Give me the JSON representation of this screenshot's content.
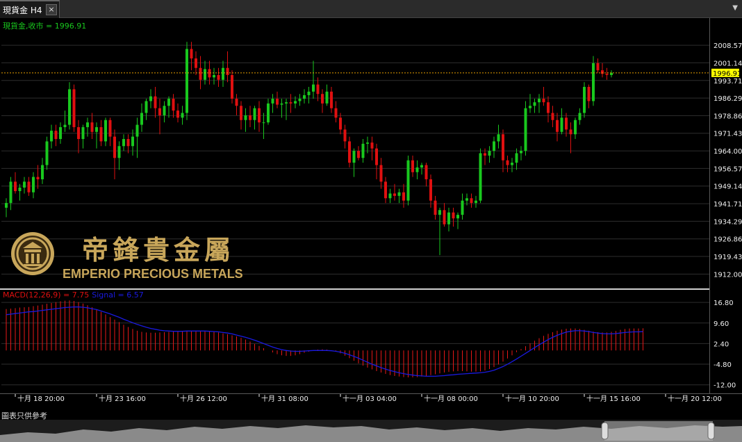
{
  "tab": {
    "title": "現貨金 H4",
    "close_label": "×",
    "menu_glyph": "▼"
  },
  "colors": {
    "up": "#19c81e",
    "down": "#e01010",
    "grid": "#2e2e2e",
    "axis_text": "#f0f0f0",
    "price_line": "#e8a000",
    "signal": "#1a1ae0",
    "macd_hist": "#e81818",
    "price_label_bg": "#ffff00"
  },
  "logo": {
    "chinese": "帝鋒貴金屬",
    "english": "EMPERIO PRECIOUS METALS",
    "icon": "emperio-emblem-icon"
  },
  "footer_note": "圖表只供參考",
  "chart_data": [
    {
      "type": "candlestick",
      "header_label": "現貨金,收市 = 1996.91",
      "last_price": 1996.91,
      "last_price_label": "1996.91",
      "ylim": [
        1908,
        2013
      ],
      "y_ticks": [
        "2008.57",
        "2001.14",
        "1993.71",
        "1986.29",
        "1978.86",
        "1971.43",
        "1964.00",
        "1956.57",
        "1949.14",
        "1941.71",
        "1934.29",
        "1926.86",
        "1919.43",
        "1912.00"
      ],
      "x_ticks": [
        "十月 18 20:00",
        "十月 23 16:00",
        "十月 26 12:00",
        "十月 31 08:00",
        "十一月 03 04:00",
        "十一月 08 00:00",
        "十一月 10 20:00",
        "十一月 15 16:00",
        "十一月 20 12:00"
      ],
      "x_tick_index": [
        2,
        20,
        38,
        56,
        74,
        92,
        110,
        128,
        146
      ],
      "ohlc": [
        [
          1940.0,
          1944.0,
          1936.0,
          1942.0
        ],
        [
          1942.0,
          1953.0,
          1939.0,
          1951.0
        ],
        [
          1951.0,
          1955.0,
          1946.0,
          1947.0
        ],
        [
          1947.0,
          1950.0,
          1943.0,
          1948.5
        ],
        [
          1948.5,
          1953.0,
          1946.0,
          1951.0
        ],
        [
          1951.0,
          1953.0,
          1945.0,
          1946.5
        ],
        [
          1946.5,
          1955.0,
          1944.0,
          1953.0
        ],
        [
          1953.0,
          1958.0,
          1948.0,
          1952.0
        ],
        [
          1952.0,
          1961.0,
          1950.0,
          1958.0
        ],
        [
          1958.0,
          1970.0,
          1956.0,
          1968.0
        ],
        [
          1968.0,
          1975.0,
          1965.0,
          1972.5
        ],
        [
          1972.5,
          1975.0,
          1966.0,
          1969.0
        ],
        [
          1969.0,
          1976.0,
          1967.0,
          1974.0
        ],
        [
          1974.0,
          1981.0,
          1972.0,
          1975.0
        ],
        [
          1975.0,
          1993.0,
          1973.0,
          1990.0
        ],
        [
          1990.0,
          1992.0,
          1972.0,
          1974.0
        ],
        [
          1974.0,
          1977.0,
          1963.0,
          1969.0
        ],
        [
          1969.0,
          1975.0,
          1965.0,
          1974.0
        ],
        [
          1974.0,
          1978.0,
          1970.0,
          1976.0
        ],
        [
          1976.0,
          1980.0,
          1969.0,
          1972.0
        ],
        [
          1972.0,
          1976.0,
          1965.0,
          1974.0
        ],
        [
          1974.0,
          1977.0,
          1966.0,
          1968.0
        ],
        [
          1968.0,
          1978.0,
          1966.0,
          1977.0
        ],
        [
          1977.0,
          1978.0,
          1966.0,
          1970.0
        ],
        [
          1970.0,
          1973.0,
          1952.0,
          1961.0
        ],
        [
          1961.0,
          1968.0,
          1956.0,
          1966.0
        ],
        [
          1966.0,
          1971.0,
          1964.0,
          1969.0
        ],
        [
          1969.0,
          1971.0,
          1963.0,
          1966.0
        ],
        [
          1966.0,
          1973.0,
          1962.0,
          1970.0
        ],
        [
          1970.0,
          1978.0,
          1961.0,
          1975.0
        ],
        [
          1975.0,
          1984.0,
          1972.0,
          1980.0
        ],
        [
          1980.0,
          1986.0,
          1977.0,
          1985.0
        ],
        [
          1985.0,
          1990.0,
          1982.0,
          1987.0
        ],
        [
          1987.0,
          1991.0,
          1978.0,
          1982.0
        ],
        [
          1982.0,
          1986.0,
          1971.0,
          1979.0
        ],
        [
          1979.0,
          1985.0,
          1976.0,
          1983.0
        ],
        [
          1983.0,
          1987.0,
          1978.0,
          1986.0
        ],
        [
          1986.0,
          1988.0,
          1978.0,
          1981.0
        ],
        [
          1981.0,
          1984.0,
          1976.0,
          1978.0
        ],
        [
          1978.0,
          1983.0,
          1975.0,
          1980.0
        ],
        [
          1980.0,
          2010.0,
          1977.0,
          2007.0
        ],
        [
          2007.0,
          2010.0,
          1998.0,
          2003.0
        ],
        [
          2003.0,
          2006.0,
          1996.0,
          1999.0
        ],
        [
          1999.0,
          2004.0,
          1990.0,
          1994.0
        ],
        [
          1994.0,
          2002.0,
          1992.0,
          1998.5
        ],
        [
          1998.5,
          2002.0,
          1992.0,
          1995.0
        ],
        [
          1995.0,
          1999.0,
          1992.0,
          1996.0
        ],
        [
          1996.0,
          1999.0,
          1991.0,
          1994.0
        ],
        [
          1994.0,
          2002.0,
          1991.0,
          1999.0
        ],
        [
          1999.0,
          2006.0,
          1993.0,
          1996.0
        ],
        [
          1996.0,
          1998.0,
          1984.0,
          1986.0
        ],
        [
          1986.0,
          1988.0,
          1979.0,
          1983.0
        ],
        [
          1983.0,
          1985.0,
          1973.0,
          1977.0
        ],
        [
          1977.0,
          1982.0,
          1972.0,
          1979.0
        ],
        [
          1979.0,
          1983.0,
          1974.0,
          1977.0
        ],
        [
          1977.0,
          1983.0,
          1973.0,
          1982.0
        ],
        [
          1982.0,
          1985.0,
          1972.0,
          1976.0
        ],
        [
          1976.0,
          1980.0,
          1969.0,
          1976.0
        ],
        [
          1976.0,
          1986.0,
          1975.0,
          1984.0
        ],
        [
          1984.0,
          1988.0,
          1980.0,
          1986.0
        ],
        [
          1986.0,
          1989.0,
          1982.0,
          1983.5
        ],
        [
          1983.5,
          1986.0,
          1978.0,
          1984.0
        ],
        [
          1984.0,
          1986.0,
          1977.0,
          1984.5
        ],
        [
          1984.5,
          1988.0,
          1980.0,
          1984.0
        ],
        [
          1984.0,
          1987.0,
          1982.0,
          1985.0
        ],
        [
          1985.0,
          1988.0,
          1983.0,
          1986.0
        ],
        [
          1986.0,
          1990.0,
          1984.0,
          1987.5
        ],
        [
          1987.5,
          1991.0,
          1984.0,
          1989.0
        ],
        [
          1989.0,
          2002.0,
          1986.0,
          1992.0
        ],
        [
          1992.0,
          1995.0,
          1985.0,
          1988.0
        ],
        [
          1988.0,
          1990.0,
          1980.0,
          1984.0
        ],
        [
          1984.0,
          1992.0,
          1983.0,
          1989.0
        ],
        [
          1989.0,
          1991.0,
          1980.0,
          1982.0
        ],
        [
          1982.0,
          1985.0,
          1976.0,
          1978.0
        ],
        [
          1978.0,
          1980.0,
          1971.0,
          1973.0
        ],
        [
          1973.0,
          1975.0,
          1965.0,
          1968.0
        ],
        [
          1968.0,
          1970.0,
          1957.0,
          1959.0
        ],
        [
          1959.0,
          1965.0,
          1953.0,
          1964.0
        ],
        [
          1964.0,
          1966.0,
          1960.0,
          1961.0
        ],
        [
          1961.0,
          1969.0,
          1959.0,
          1967.0
        ],
        [
          1967.0,
          1970.0,
          1963.0,
          1967.5
        ],
        [
          1967.5,
          1970.0,
          1960.0,
          1965.0
        ],
        [
          1965.0,
          1967.0,
          1952.0,
          1958.0
        ],
        [
          1958.0,
          1961.0,
          1948.0,
          1951.0
        ],
        [
          1951.0,
          1953.0,
          1942.0,
          1944.0
        ],
        [
          1944.0,
          1948.0,
          1942.0,
          1946.0
        ],
        [
          1946.0,
          1950.0,
          1943.0,
          1945.0
        ],
        [
          1945.0,
          1948.0,
          1942.0,
          1946.5
        ],
        [
          1946.5,
          1950.0,
          1940.0,
          1943.0
        ],
        [
          1943.0,
          1962.0,
          1941.0,
          1960.0
        ],
        [
          1960.0,
          1962.0,
          1953.0,
          1955.0
        ],
        [
          1955.0,
          1960.0,
          1952.0,
          1957.0
        ],
        [
          1957.0,
          1959.0,
          1954.0,
          1958.0
        ],
        [
          1958.0,
          1959.0,
          1949.0,
          1952.0
        ],
        [
          1952.0,
          1954.0,
          1940.0,
          1943.0
        ],
        [
          1943.0,
          1945.0,
          1935.0,
          1937.0
        ],
        [
          1937.0,
          1940.0,
          1920.0,
          1939.0
        ],
        [
          1939.0,
          1942.0,
          1932.0,
          1933.0
        ],
        [
          1933.0,
          1940.0,
          1930.0,
          1938.0
        ],
        [
          1938.0,
          1940.0,
          1932.0,
          1935.5
        ],
        [
          1935.5,
          1938.0,
          1931.0,
          1937.0
        ],
        [
          1937.0,
          1946.0,
          1935.0,
          1943.0
        ],
        [
          1943.0,
          1946.0,
          1941.0,
          1944.0
        ],
        [
          1944.0,
          1946.0,
          1940.0,
          1942.0
        ],
        [
          1942.0,
          1945.0,
          1940.0,
          1943.0
        ],
        [
          1943.0,
          1965.0,
          1942.0,
          1963.0
        ],
        [
          1963.0,
          1965.0,
          1958.0,
          1962.0
        ],
        [
          1962.0,
          1966.0,
          1959.0,
          1964.0
        ],
        [
          1964.0,
          1970.0,
          1961.0,
          1968.0
        ],
        [
          1968.0,
          1975.0,
          1965.0,
          1971.0
        ],
        [
          1971.0,
          1973.0,
          1955.0,
          1960.0
        ],
        [
          1960.0,
          1962.0,
          1955.0,
          1958.0
        ],
        [
          1958.0,
          1961.0,
          1955.0,
          1959.0
        ],
        [
          1959.0,
          1965.0,
          1956.0,
          1963.0
        ],
        [
          1963.0,
          1966.0,
          1960.0,
          1964.0
        ],
        [
          1964.0,
          1985.0,
          1962.0,
          1982.0
        ],
        [
          1982.0,
          1988.0,
          1980.0,
          1983.0
        ],
        [
          1983.0,
          1986.0,
          1980.0,
          1984.5
        ],
        [
          1984.5,
          1988.0,
          1980.0,
          1986.0
        ],
        [
          1986.0,
          1991.0,
          1983.0,
          1984.5
        ],
        [
          1984.5,
          1987.0,
          1976.0,
          1980.0
        ],
        [
          1980.0,
          1983.0,
          1974.0,
          1977.0
        ],
        [
          1977.0,
          1980.0,
          1968.0,
          1972.0
        ],
        [
          1972.0,
          1982.0,
          1971.0,
          1978.0
        ],
        [
          1978.0,
          1980.0,
          1970.0,
          1973.0
        ],
        [
          1973.0,
          1976.0,
          1963.0,
          1971.0
        ],
        [
          1971.0,
          1978.0,
          1969.0,
          1977.0
        ],
        [
          1977.0,
          1982.0,
          1975.0,
          1980.0
        ],
        [
          1980.0,
          1993.0,
          1978.0,
          1991.0
        ],
        [
          1991.0,
          1992.0,
          1982.0,
          1985.0
        ],
        [
          1985.0,
          2004.0,
          1983.0,
          2001.0
        ],
        [
          2001.0,
          2003.0,
          1997.0,
          1998.0
        ],
        [
          1998.0,
          2001.0,
          1995.0,
          1996.5
        ],
        [
          1996.5,
          1999.0,
          1994.0,
          1996.0
        ],
        [
          1996.0,
          1998.0,
          1995.0,
          1996.91
        ]
      ]
    },
    {
      "type": "macd",
      "label": "MACD(12,26,9) = 7.75",
      "signal_label": "Signal = 6.57",
      "macd_value": 7.75,
      "signal_value": 6.57,
      "ylim": [
        -14.5,
        19.5
      ],
      "y_ticks": [
        "16.80",
        "9.60",
        "2.40",
        "-4.80",
        "-12.00"
      ],
      "histogram": [
        14.5,
        14.6,
        14.8,
        15.0,
        15.1,
        15.2,
        15.5,
        15.7,
        16.0,
        16.3,
        16.6,
        16.9,
        17.2,
        17.4,
        17.5,
        17.3,
        16.9,
        16.4,
        15.8,
        15.1,
        14.3,
        13.5,
        12.6,
        11.7,
        10.8,
        9.9,
        9.0,
        8.2,
        7.5,
        6.9,
        6.5,
        6.3,
        6.2,
        6.2,
        6.3,
        6.4,
        6.5,
        6.6,
        6.8,
        6.8,
        6.9,
        6.9,
        6.9,
        6.9,
        6.8,
        6.7,
        6.5,
        6.3,
        6.0,
        5.7,
        5.3,
        4.9,
        4.4,
        3.8,
        3.1,
        2.3,
        1.6,
        0.8,
        0.0,
        -0.7,
        -1.3,
        -1.7,
        -1.9,
        -1.9,
        -1.7,
        -1.3,
        -0.8,
        -0.4,
        0.0,
        0.3,
        0.4,
        0.3,
        0.0,
        -0.4,
        -1.0,
        -1.8,
        -2.7,
        -3.6,
        -4.5,
        -5.3,
        -6.0,
        -6.6,
        -7.2,
        -7.7,
        -8.2,
        -8.6,
        -8.9,
        -9.1,
        -9.3,
        -9.4,
        -9.4,
        -9.3,
        -9.1,
        -8.9,
        -8.6,
        -8.3,
        -8.0,
        -7.7,
        -7.5,
        -7.3,
        -7.2,
        -7.2,
        -7.3,
        -7.4,
        -7.4,
        -7.3,
        -7.0,
        -6.5,
        -5.8,
        -4.9,
        -3.9,
        -2.8,
        -1.7,
        -0.6,
        0.5,
        1.5,
        2.5,
        3.4,
        4.3,
        5.1,
        5.8,
        6.4,
        6.9,
        7.3,
        7.6,
        7.7,
        7.7,
        7.5,
        7.2,
        6.9,
        6.6,
        6.4,
        6.3,
        6.3,
        6.5,
        6.8,
        7.2,
        7.5,
        7.7,
        7.7,
        7.7,
        7.75
      ],
      "signal": [
        12.5,
        12.7,
        12.9,
        13.1,
        13.3,
        13.5,
        13.6,
        13.8,
        14.0,
        14.2,
        14.4,
        14.6,
        14.8,
        15.0,
        15.1,
        15.2,
        15.2,
        15.1,
        14.9,
        14.6,
        14.3,
        13.8,
        13.3,
        12.8,
        12.2,
        11.6,
        10.9,
        10.3,
        9.7,
        9.1,
        8.6,
        8.1,
        7.7,
        7.4,
        7.1,
        6.9,
        6.8,
        6.7,
        6.7,
        6.7,
        6.8,
        6.8,
        6.8,
        6.8,
        6.8,
        6.7,
        6.6,
        6.5,
        6.3,
        6.1,
        5.8,
        5.4,
        5.0,
        4.6,
        4.1,
        3.6,
        3.0,
        2.4,
        1.8,
        1.2,
        0.7,
        0.3,
        0.0,
        -0.2,
        -0.3,
        -0.3,
        -0.2,
        -0.1,
        0.0,
        0.0,
        0.0,
        0.0,
        -0.1,
        -0.3,
        -0.6,
        -1.0,
        -1.5,
        -2.1,
        -2.7,
        -3.4,
        -4.1,
        -4.8,
        -5.4,
        -6.0,
        -6.5,
        -7.0,
        -7.4,
        -7.8,
        -8.1,
        -8.4,
        -8.6,
        -8.8,
        -8.9,
        -9.0,
        -9.0,
        -9.0,
        -8.9,
        -8.8,
        -8.6,
        -8.5,
        -8.3,
        -8.2,
        -8.1,
        -8.0,
        -7.9,
        -7.8,
        -7.6,
        -7.3,
        -6.9,
        -6.3,
        -5.6,
        -4.8,
        -3.9,
        -3.0,
        -2.0,
        -1.0,
        0.0,
        1.0,
        2.0,
        2.9,
        3.8,
        4.6,
        5.3,
        5.9,
        6.4,
        6.7,
        6.9,
        6.9,
        6.8,
        6.6,
        6.3,
        6.1,
        5.9,
        5.8,
        5.8,
        5.9,
        6.1,
        6.3,
        6.4,
        6.5,
        6.5,
        6.57
      ]
    }
  ]
}
